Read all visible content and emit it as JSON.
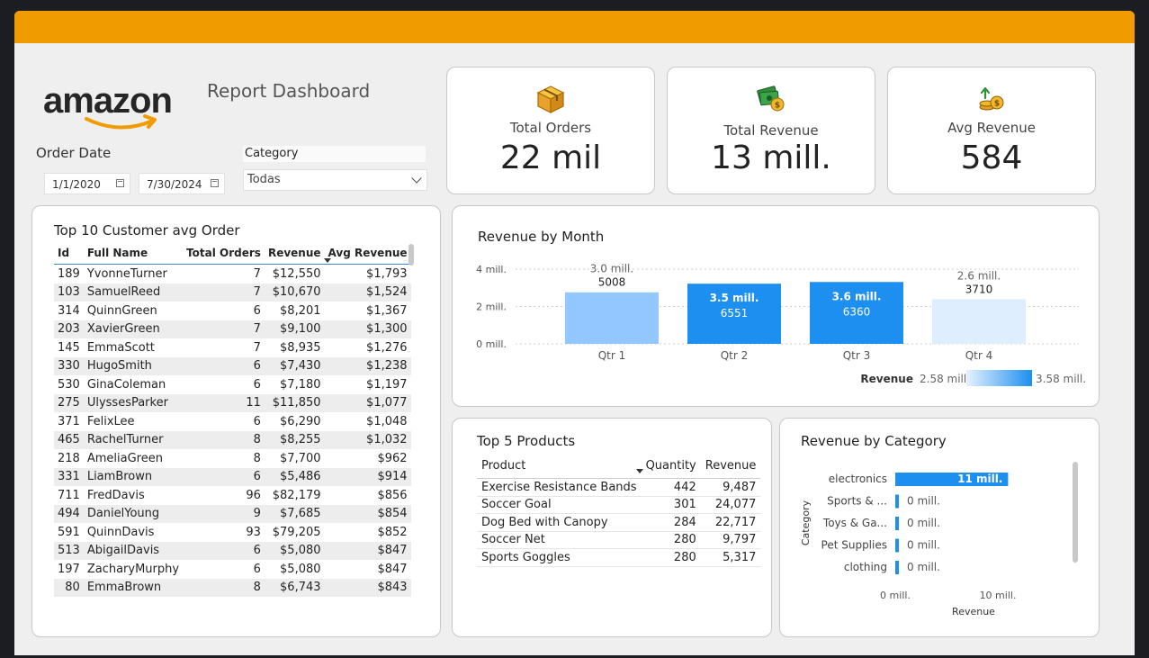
{
  "header": {
    "logo_text": "amazon",
    "report_title": "Report Dashboard"
  },
  "filters": {
    "order_date_label": "Order Date",
    "start_date": "1/1/2020",
    "end_date": "7/30/2024",
    "category_label": "Category",
    "category_value": "Todas"
  },
  "kpis": [
    {
      "label": "Total Orders",
      "value": "22 mil",
      "icon": "package-box-icon"
    },
    {
      "label": "Total Revenue",
      "value": "13 mill.",
      "icon": "money-stack-icon"
    },
    {
      "label": "Avg Revenue",
      "value": "584",
      "icon": "coins-growth-icon"
    }
  ],
  "customers": {
    "title": "Top 10 Customer avg Order",
    "headers": [
      "Id",
      "Full Name",
      "Total Orders",
      "Revenue",
      "Avg Revenue"
    ],
    "rows": [
      [
        "189",
        "YvonneTurner",
        "7",
        "$12,550",
        "$1,793"
      ],
      [
        "103",
        "SamuelReed",
        "7",
        "$10,670",
        "$1,524"
      ],
      [
        "314",
        "QuinnGreen",
        "6",
        "$8,201",
        "$1,367"
      ],
      [
        "203",
        "XavierGreen",
        "7",
        "$9,100",
        "$1,300"
      ],
      [
        "145",
        "EmmaScott",
        "7",
        "$8,935",
        "$1,276"
      ],
      [
        "330",
        "HugoSmith",
        "6",
        "$7,430",
        "$1,238"
      ],
      [
        "530",
        "GinaColeman",
        "6",
        "$7,180",
        "$1,197"
      ],
      [
        "275",
        "UlyssesParker",
        "11",
        "$11,850",
        "$1,077"
      ],
      [
        "371",
        "FelixLee",
        "6",
        "$6,290",
        "$1,048"
      ],
      [
        "465",
        "RachelTurner",
        "8",
        "$8,255",
        "$1,032"
      ],
      [
        "218",
        "AmeliaGreen",
        "8",
        "$7,700",
        "$962"
      ],
      [
        "331",
        "LiamBrown",
        "6",
        "$5,486",
        "$914"
      ],
      [
        "711",
        "FredDavis",
        "96",
        "$82,179",
        "$856"
      ],
      [
        "494",
        "DanielYoung",
        "9",
        "$7,685",
        "$854"
      ],
      [
        "591",
        "QuinnDavis",
        "93",
        "$79,205",
        "$852"
      ],
      [
        "513",
        "AbigailDavis",
        "6",
        "$5,080",
        "$847"
      ],
      [
        "197",
        "ZacharyMurphy",
        "6",
        "$5,080",
        "$847"
      ],
      [
        "80",
        "EmmaBrown",
        "8",
        "$6,743",
        "$843"
      ]
    ]
  },
  "chart_data": [
    {
      "type": "bar",
      "title": "Revenue by Month",
      "categories": [
        "Qtr 1",
        "Qtr 2",
        "Qtr 3",
        "Qtr 4"
      ],
      "values": [
        3.0,
        3.5,
        3.6,
        2.6
      ],
      "value_labels": [
        "3.0 mill.",
        "3.5 mill.",
        "3.6 mill.",
        "2.6 mill."
      ],
      "secondary_labels": [
        "5008",
        "6551",
        "6360",
        "3710"
      ],
      "colors": [
        "#92c8ff",
        "#1c8ff0",
        "#1c8ff0",
        "#deeeff"
      ],
      "y_ticks": [
        "4 mill.",
        "2 mill.",
        "0 mill."
      ],
      "ylim": [
        0,
        4
      ],
      "legend": {
        "title": "Revenue",
        "min_label": "2.58 mill.",
        "max_label": "3.58 mill.",
        "min_color": "#e6f2ff",
        "max_color": "#1c8ff0"
      },
      "grid": true
    },
    {
      "type": "bar",
      "orientation": "horizontal",
      "title": "Revenue by Category",
      "categories": [
        "electronics",
        "Sports & ...",
        "Toys & Ga...",
        "Pet Supplies",
        "clothing"
      ],
      "values": [
        11,
        0.1,
        0.1,
        0.1,
        0.1
      ],
      "value_labels": [
        "11 mill.",
        "0 mill.",
        "0 mill.",
        "0 mill.",
        "0 mill."
      ],
      "x_ticks": [
        "0 mill.",
        "10 mill."
      ],
      "xlim": [
        0,
        10
      ],
      "xlabel": "Revenue",
      "ylabel": "Category",
      "color": "#1c8ff0"
    }
  ],
  "products": {
    "title": "Top 5 Products",
    "headers": [
      "Product",
      "Quantity",
      "Revenue"
    ],
    "rows": [
      [
        "Exercise Resistance Bands",
        "442",
        "9,487"
      ],
      [
        "Soccer Goal",
        "301",
        "24,077"
      ],
      [
        "Dog Bed with Canopy",
        "284",
        "22,717"
      ],
      [
        "Soccer Net",
        "280",
        "9,797"
      ],
      [
        "Sports Goggles",
        "280",
        "5,317"
      ]
    ]
  }
}
